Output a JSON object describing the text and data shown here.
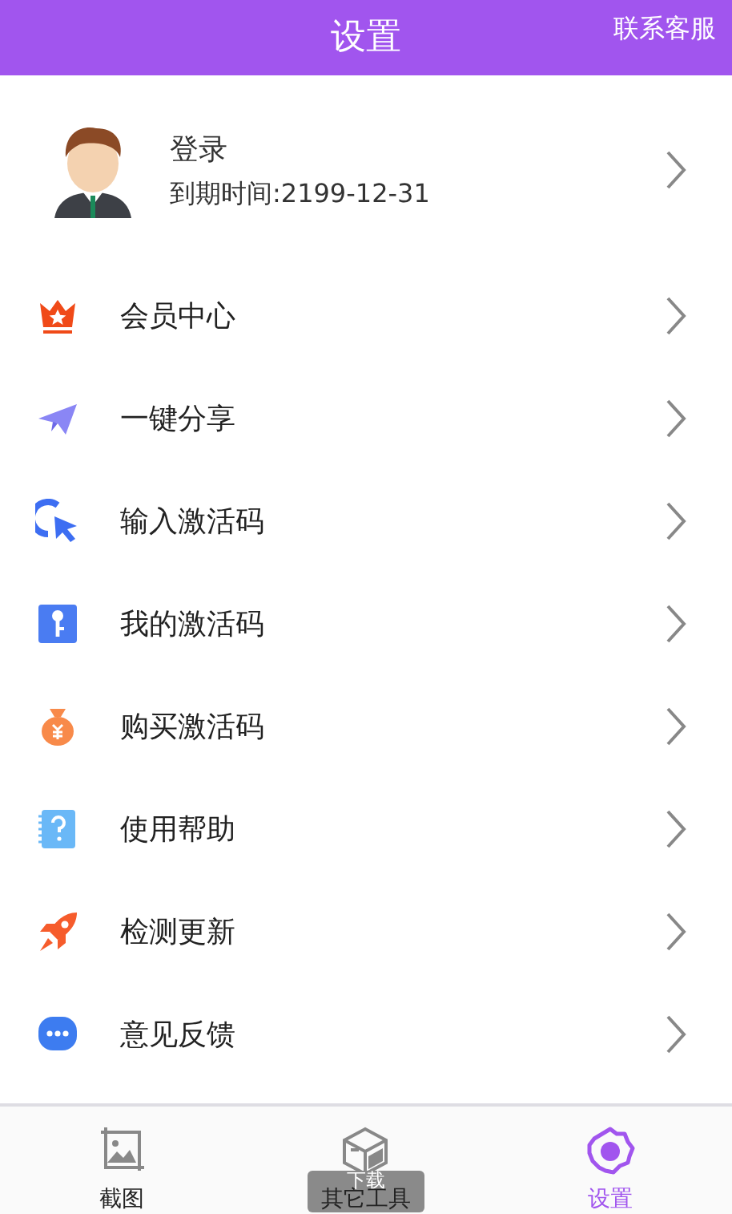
{
  "header": {
    "title": "设置",
    "action": "联系客服"
  },
  "profile": {
    "name": "登录",
    "expiry": "到期时间:2199-12-31"
  },
  "menu": [
    {
      "kind": "crown",
      "label": "会员中心"
    },
    {
      "kind": "plane",
      "label": "一键分享"
    },
    {
      "kind": "cursor",
      "label": "输入激活码"
    },
    {
      "kind": "key",
      "label": "我的激活码"
    },
    {
      "kind": "moneybag",
      "label": "购买激活码"
    },
    {
      "kind": "help",
      "label": "使用帮助"
    },
    {
      "kind": "rocket",
      "label": "检测更新"
    },
    {
      "kind": "chat",
      "label": "意见反馈"
    }
  ],
  "tabs": [
    {
      "kind": "image",
      "label": "截图",
      "selected": false
    },
    {
      "kind": "box",
      "label": "其它工具",
      "selected": false
    },
    {
      "kind": "gear",
      "label": "设置",
      "selected": true
    }
  ],
  "toast": "下载"
}
